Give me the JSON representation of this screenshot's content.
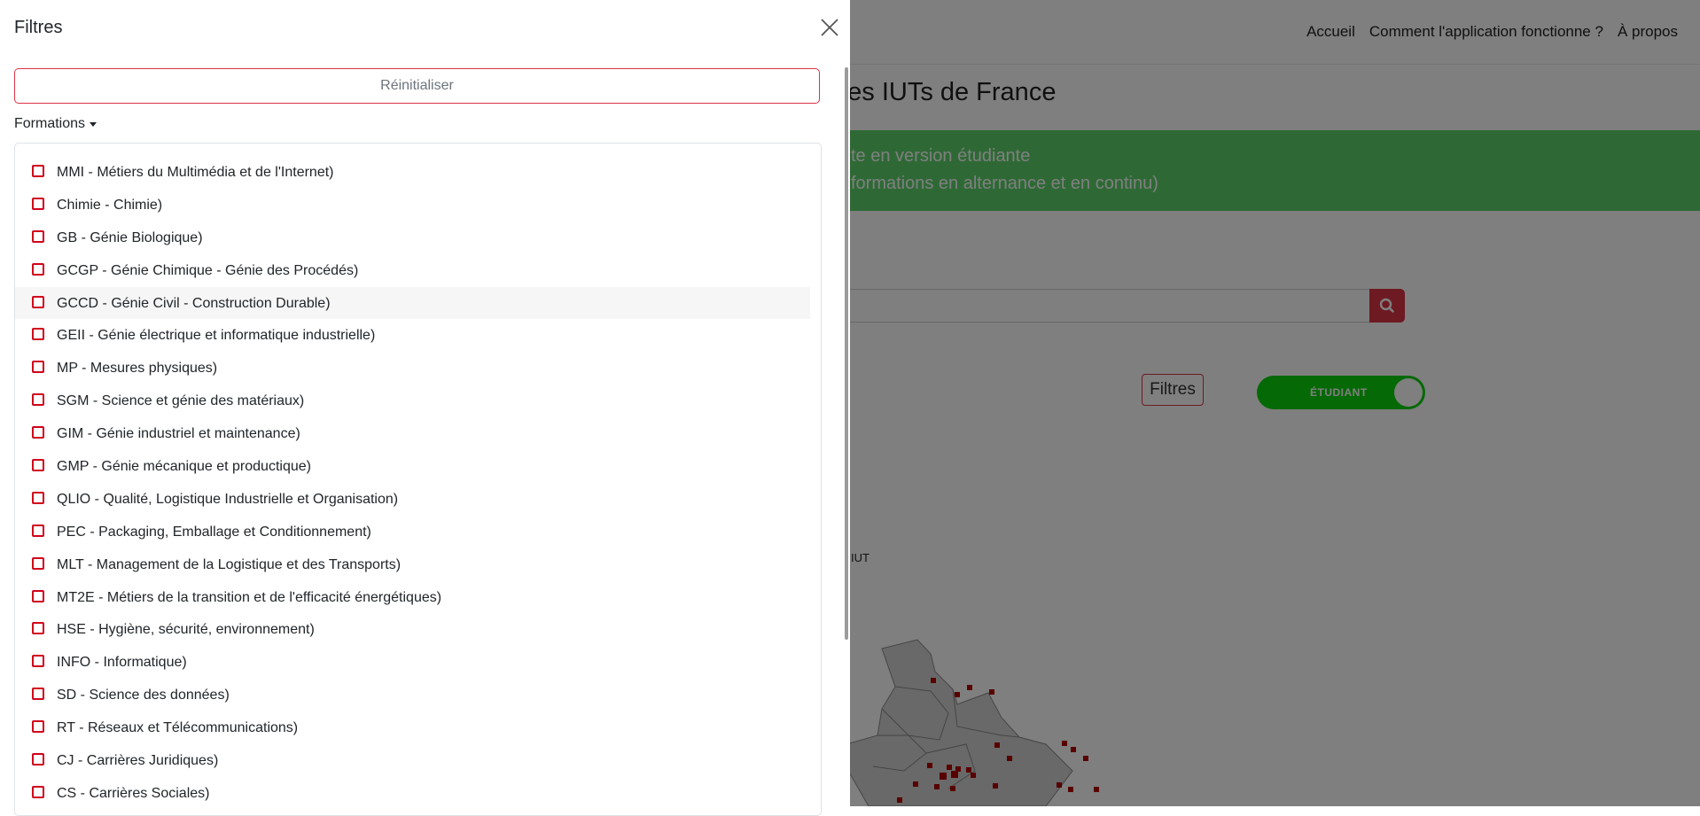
{
  "nav": {
    "items": [
      "Accueil",
      "Comment l'application fonctionne ?",
      "À propos"
    ]
  },
  "page": {
    "title_visible": "des IUTs de France",
    "banner_line1": "te en version étudiante",
    "banner_line2": "formations en alternance et en continu)",
    "filters_button": "Filtres",
    "mode_toggle": "ÉTUDIANT",
    "map_label": "IUT"
  },
  "offcanvas": {
    "title": "Filtres",
    "reset_label": "Réinitialiser",
    "formations_label": "Formations",
    "items": [
      "MMI - Métiers du Multimédia et de l'Internet)",
      "Chimie - Chimie)",
      "GB - Génie Biologique)",
      "GCGP - Génie Chimique - Génie des Procédés)",
      "GCCD - Génie Civil - Construction Durable)",
      "GEII - Génie électrique et informatique industrielle)",
      "MP - Mesures physiques)",
      "SGM - Science et génie des matériaux)",
      "GIM - Génie industriel et maintenance)",
      "GMP - Génie mécanique et productique)",
      "QLIO - Qualité, Logistique Industrielle et Organisation)",
      "PEC - Packaging, Emballage et Conditionnement)",
      "MLT - Management de la Logistique et des Transports)",
      "MT2E - Métiers de la transition et de l'efficacité énergétiques)",
      "HSE - Hygiène, sécurité, environnement)",
      "INFO - Informatique)",
      "SD - Science des données)",
      "RT - Réseaux et Télécommunications)",
      "CJ - Carrières Juridiques)",
      "CS - Carrières Sociales)"
    ]
  },
  "colors": {
    "accent": "#dc3545",
    "checkbox": "#d0021b",
    "banner": "#5cd36a",
    "toggle": "#0bd30b"
  },
  "icons": {
    "close": "close-icon",
    "search": "search-icon",
    "caret": "caret-down-icon"
  }
}
